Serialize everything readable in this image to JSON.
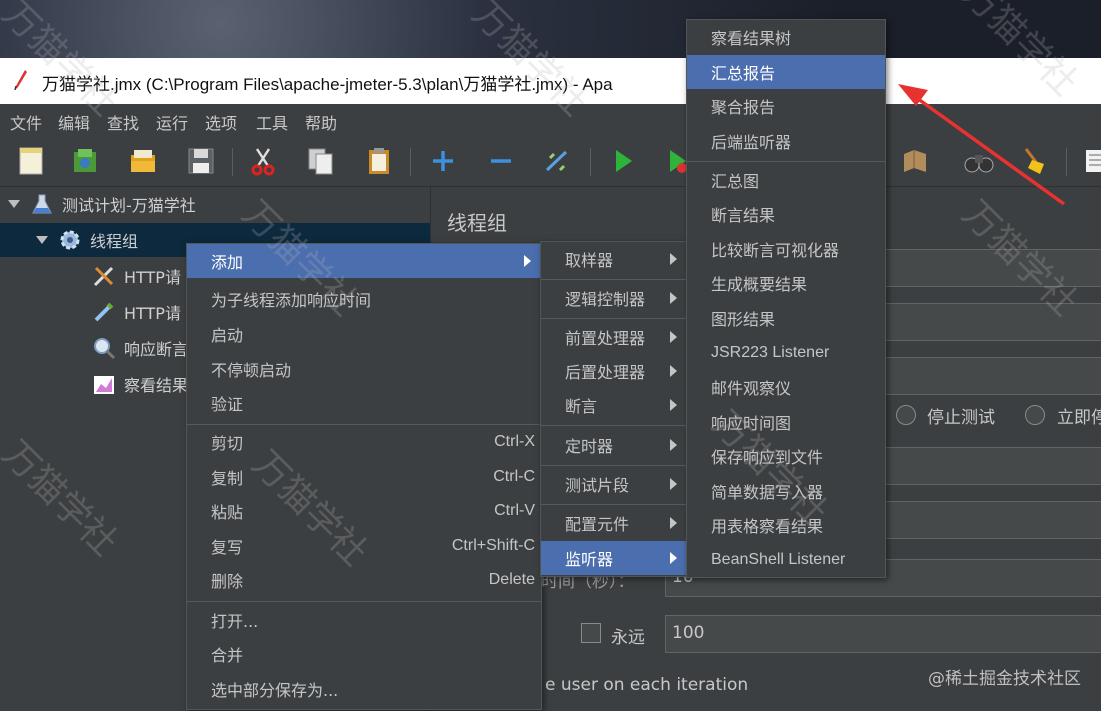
{
  "window": {
    "title": "万猫学社.jmx (C:\\Program Files\\apache-jmeter-5.3\\plan\\万猫学社.jmx) - Apa"
  },
  "menubar": [
    "文件",
    "编辑",
    "查找",
    "运行",
    "选项",
    "工具",
    "帮助"
  ],
  "tree": {
    "root": "测试计划-万猫学社",
    "thread_group": "线程组",
    "children": [
      "HTTP请",
      "HTTP请",
      "响应断言",
      "察看结果"
    ]
  },
  "panel": {
    "title": "线程组",
    "radio_stop_test": "停止测试",
    "radio_stop_now": "立即停",
    "duration_label_partial": "时间（秒）：",
    "duration_value": "10",
    "forever_label": "永远",
    "loop_value": "100",
    "iteration_text": "e user on each iteration"
  },
  "context_menu": {
    "items": [
      {
        "label": "添加",
        "submenu": true
      },
      {
        "label": "为子线程添加响应时间"
      },
      {
        "label": "启动"
      },
      {
        "label": "不停顿启动"
      },
      {
        "label": "验证"
      },
      {
        "label": "剪切",
        "shortcut": "Ctrl-X"
      },
      {
        "label": "复制",
        "shortcut": "Ctrl-C"
      },
      {
        "label": "粘贴",
        "shortcut": "Ctrl-V"
      },
      {
        "label": "复写",
        "shortcut": "Ctrl+Shift-C"
      },
      {
        "label": "删除",
        "shortcut": "Delete"
      },
      {
        "label": "打开..."
      },
      {
        "label": "合并"
      },
      {
        "label": "选中部分保存为..."
      }
    ]
  },
  "add_submenu": {
    "items": [
      "取样器",
      "逻辑控制器",
      "前置处理器",
      "后置处理器",
      "断言",
      "定时器",
      "测试片段",
      "配置元件",
      "监听器"
    ]
  },
  "listener_submenu": {
    "items": [
      "察看结果树",
      "汇总报告",
      "聚合报告",
      "后端监听器",
      "汇总图",
      "断言结果",
      "比较断言可视化器",
      "生成概要结果",
      "图形结果",
      "JSR223 Listener",
      "邮件观察仪",
      "响应时间图",
      "保存响应到文件",
      "简单数据写入器",
      "用表格察看结果",
      "BeanShell Listener"
    ]
  },
  "watermark": "万猫学社",
  "credit": "@稀土掘金技术社区",
  "colors": {
    "highlight": "#4b6eaf",
    "background": "#3c3f41",
    "selection": "#0d293e",
    "arrow": "#e8322f"
  }
}
